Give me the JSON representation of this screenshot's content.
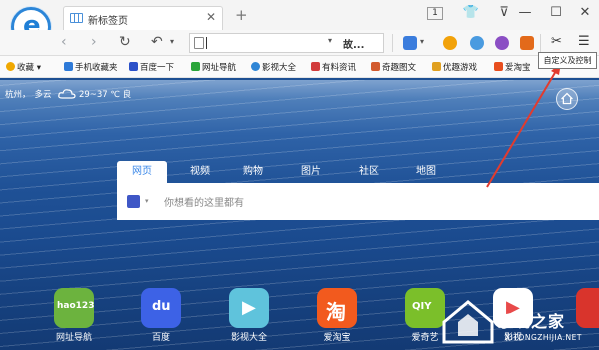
{
  "tab": {
    "label": "新标签页",
    "close": "✕"
  },
  "titlebar": {
    "new_tab": "+",
    "tab_count": "1",
    "shirt": "👕",
    "pin": "⊽",
    "minimize": "—",
    "maximize": "☐",
    "close": "✕"
  },
  "nav": {
    "back": "‹",
    "forward": "›",
    "refresh": "↻",
    "undo": "↶",
    "undo_menu": "▾",
    "search_engine": "故...",
    "dropdown": "▾",
    "menu": "☰",
    "cut": "✂"
  },
  "tooltip": "自定义及控制",
  "bookmarks": [
    {
      "label": "收藏",
      "arrow": "▾",
      "color": "#f0a800"
    },
    {
      "label": "手机收藏夹",
      "color": "#2e7ad8"
    },
    {
      "label": "百度一下",
      "color": "#2b50c8"
    },
    {
      "label": "网址导航",
      "color": "#2aa53a"
    },
    {
      "label": "影视大全",
      "color": "#2f86d6"
    },
    {
      "label": "有料资讯",
      "color": "#d23c3c"
    },
    {
      "label": "奇趣图文",
      "color": "#d25a2e"
    },
    {
      "label": "优趣游戏",
      "color": "#e0a020"
    },
    {
      "label": "爱淘宝",
      "color": "#e84e1e"
    }
  ],
  "weather": {
    "city": "杭州，",
    "condition": "多云",
    "temp": "29~37 ℃ 良"
  },
  "search": {
    "tabs": [
      "网页",
      "视频",
      "购物",
      "图片",
      "社区",
      "地图"
    ],
    "active_tab": "网页",
    "placeholder": "你想看的这里都有"
  },
  "apps": [
    {
      "label": "网址导航",
      "text": "hao123",
      "color": "#6cb33e"
    },
    {
      "label": "百度",
      "text": "du",
      "color": "#3d62e6"
    },
    {
      "label": "影视大全",
      "text": "▶",
      "color": "#5fc3dc"
    },
    {
      "label": "爱淘宝",
      "text": "淘",
      "color": "#f25a1e"
    },
    {
      "label": "爱奇艺",
      "text": "QIY",
      "color": "#7bbf2a"
    },
    {
      "label": "影视",
      "text": "▶",
      "color": "#ffffff"
    },
    {
      "label": "",
      "text": "",
      "color": "#d9342c"
    }
  ],
  "watermark": {
    "text": "系统之家",
    "url": "XITONGZHIJIA.NET"
  }
}
